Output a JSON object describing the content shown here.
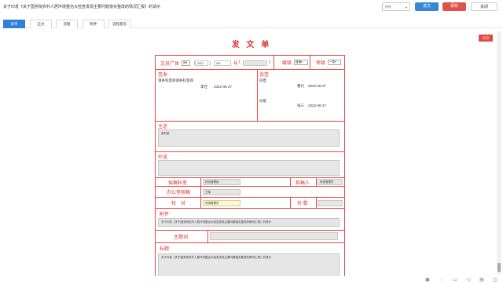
{
  "header": {
    "title": "关于印发《关于国务院农村人居环境整治大检查发现主要问题落实整改的情况汇报》的请示",
    "status_value": "待办",
    "send_label": "发文",
    "save_label": "保存",
    "close_label": "关闭"
  },
  "tabs": [
    {
      "label": "表单"
    },
    {
      "label": "正文"
    },
    {
      "label": "流程"
    },
    {
      "label": "附件"
    },
    {
      "label": "流程意见"
    }
  ],
  "print_label": "打印",
  "form": {
    "title": "发 文 单",
    "doc_no": {
      "label": "文员广体",
      "type_value": "请",
      "year": "2022",
      "serial": "001",
      "hao_label": "号",
      "right_paren": ")",
      "left_paren_year": "〔",
      "right_paren_year": "〕",
      "suffix_paren": "("
    },
    "urgency": {
      "label": "缓级",
      "value": "普通"
    },
    "secret": {
      "label": "密级",
      "value": "一般"
    },
    "sign": {
      "label": "签发",
      "opinion": "请各科室阅请各科室阅",
      "person": "李佳",
      "date": "2022-06-27"
    },
    "countersign": {
      "label": "会签",
      "entries": [
        {
          "opinion": "同意",
          "person": "曹们",
          "date": "2022-06-27"
        },
        {
          "opinion": "同意",
          "person": "张三",
          "date": "2022-06-27"
        }
      ]
    },
    "main_send": {
      "label": "主送",
      "value": "各科室"
    },
    "copy_send": {
      "label": "抄送",
      "value": ""
    },
    "draft_dept": {
      "label": "拟稿科室",
      "value": "综合管理部"
    },
    "drafter": {
      "label": "拟稿人",
      "value": "系统管理员"
    },
    "office_check": {
      "label": "办公室核稿",
      "value": "王辉"
    },
    "proofread": {
      "label": "校　对",
      "value": "系统管理员"
    },
    "copies": {
      "label": "份 数",
      "value": ""
    },
    "attachment": {
      "label": "附件",
      "value": "关于印发《关于国务院农村人居环境整治大检查发现主要问题落实整改的情况汇报》的请示"
    },
    "keywords": {
      "label": "主题词",
      "value": ""
    },
    "subject": {
      "label": "标题",
      "value": "关于印发《关于国务院农村人居环境整治大检查发现主要问题落实整改的情况汇报》的请示"
    }
  },
  "colors": {
    "accent": "#2f80d8",
    "danger": "#e0312b",
    "form_line": "#ee4444"
  },
  "statusbar_icons": [
    "image-icon",
    "chat-icon",
    "comment-icon",
    "speaker-icon",
    "notepad-icon",
    "dock-icon"
  ]
}
